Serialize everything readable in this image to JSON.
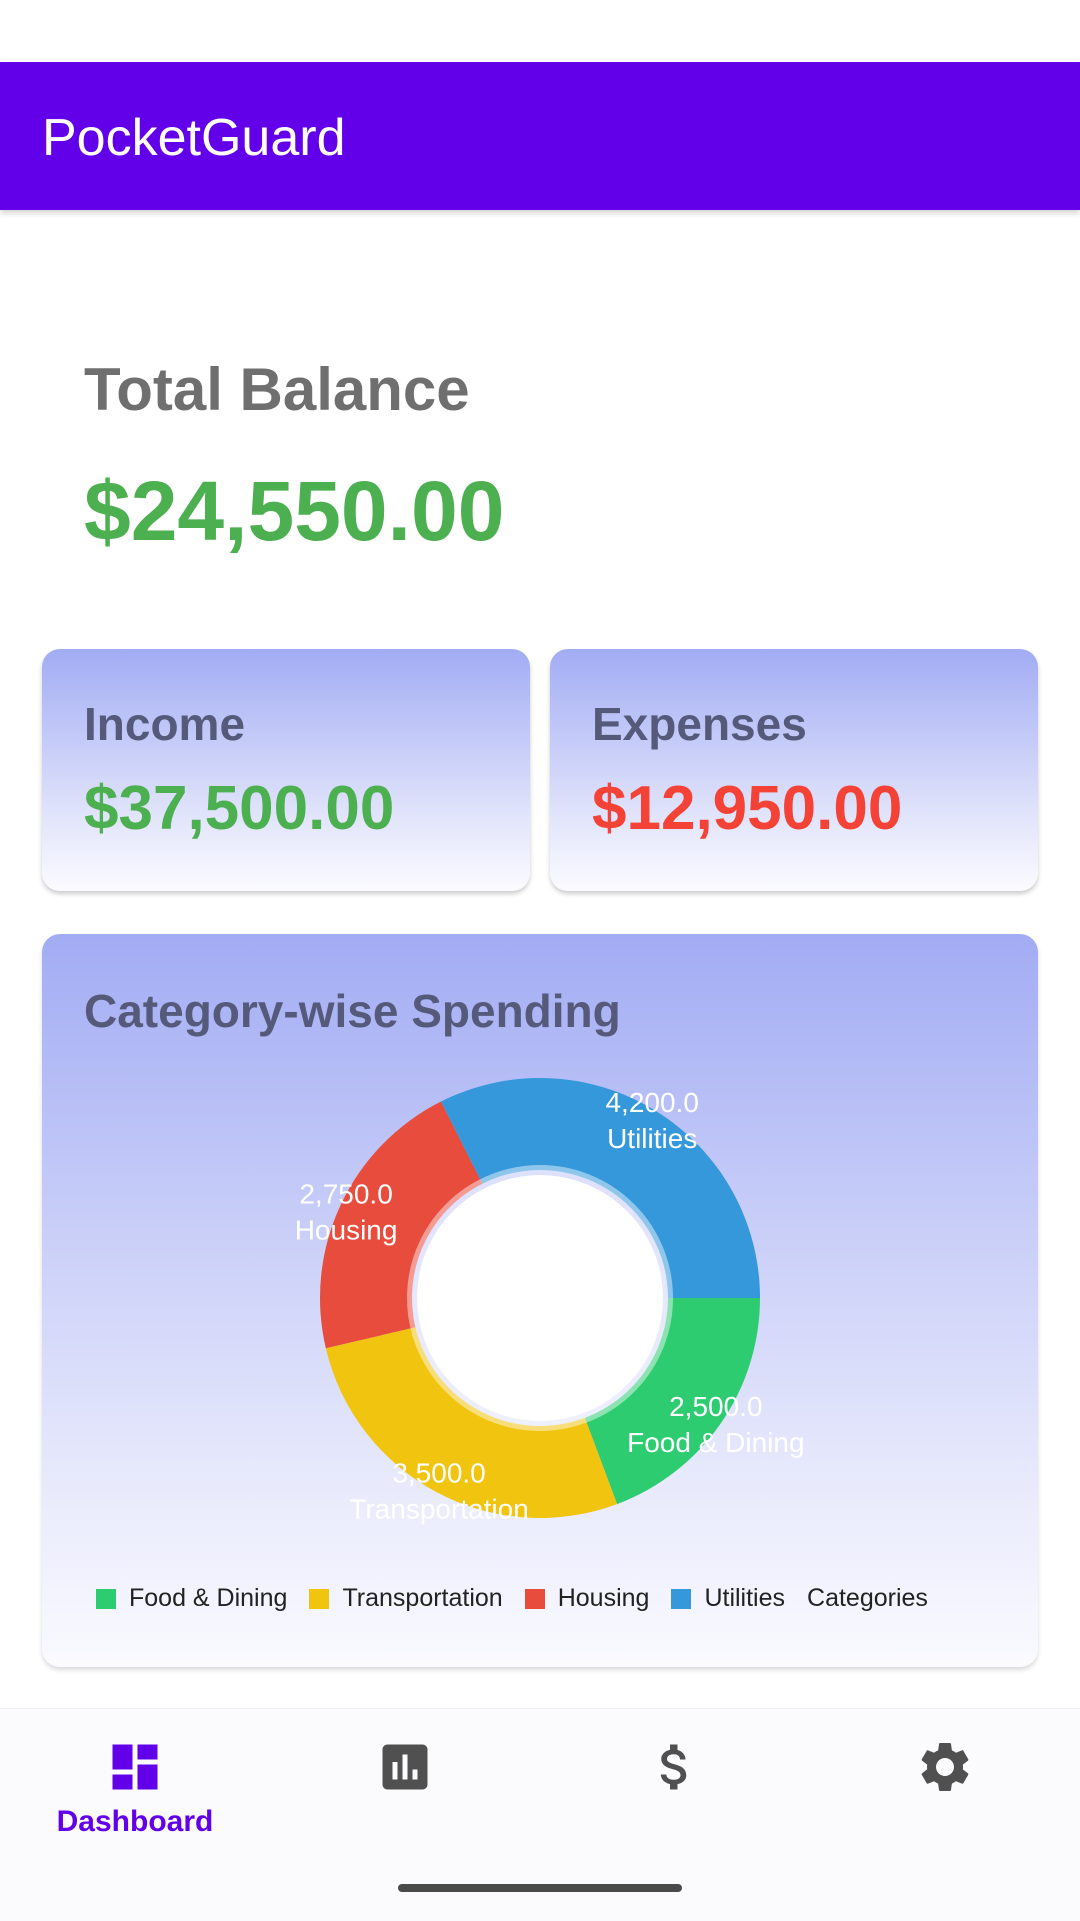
{
  "app": {
    "title": "PocketGuard"
  },
  "balance": {
    "label": "Total Balance",
    "value": "$24,550.00",
    "value_color": "#4caf50"
  },
  "income": {
    "label": "Income",
    "value": "$37,500.00",
    "value_color": "#4caf50"
  },
  "expenses": {
    "label": "Expenses",
    "value": "$12,950.00",
    "value_color": "#f44336"
  },
  "chart_card": {
    "title": "Category-wise Spending"
  },
  "chart_data": {
    "type": "pie",
    "donut": true,
    "title": "Category-wise Spending",
    "categories": [
      "Food & Dining",
      "Transportation",
      "Housing",
      "Utilities"
    ],
    "values": [
      2500.0,
      3500.0,
      2750.0,
      4200.0
    ],
    "value_labels": [
      "2,500.0",
      "3,500.0",
      "2,750.0",
      "4,200.0"
    ],
    "colors": [
      "#2ecc71",
      "#f1c40f",
      "#e74c3c",
      "#3498db"
    ],
    "legend_position": "bottom",
    "legend_suffix": "Categories"
  },
  "nav": {
    "items": [
      {
        "label": "Dashboard",
        "icon": "dashboard-icon",
        "active": true
      },
      {
        "label": "",
        "icon": "bar-chart-icon",
        "active": false
      },
      {
        "label": "",
        "icon": "dollar-icon",
        "active": false
      },
      {
        "label": "",
        "icon": "gear-icon",
        "active": false
      }
    ],
    "active_color": "#6200ea",
    "inactive_color": "#505050"
  }
}
